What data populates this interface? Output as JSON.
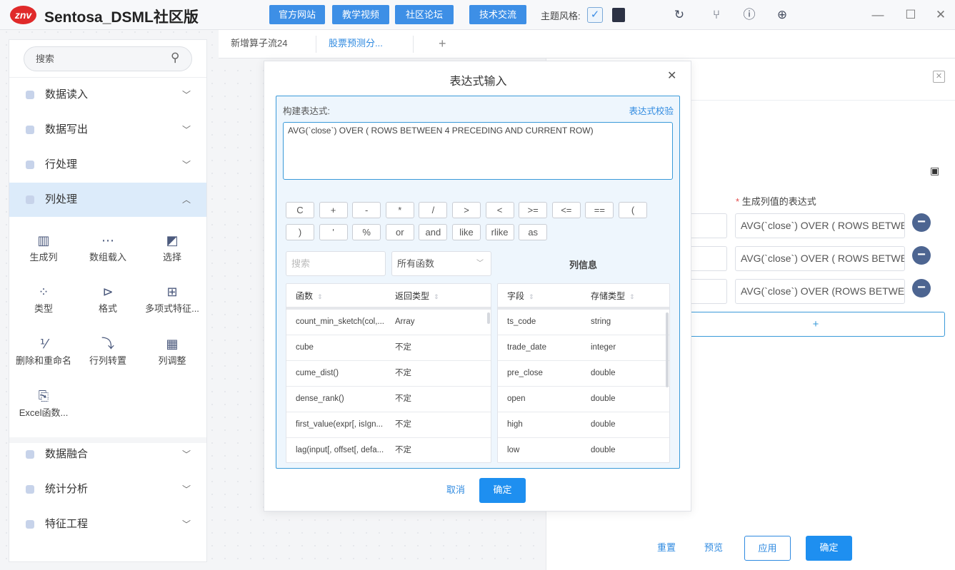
{
  "app": {
    "logo": "znv",
    "title": "Sentosa_DSML社区版"
  },
  "topbar": {
    "buttons": [
      "官方网站",
      "教学视频",
      "社区论坛",
      "技术交流"
    ],
    "theme_label": "主题风格:",
    "icons": [
      "refresh-icon",
      "branch-icon",
      "help-icon",
      "globe-icon"
    ],
    "window": [
      "minimize-icon",
      "maximize-icon",
      "close-icon"
    ]
  },
  "sidebar": {
    "search_placeholder": "搜索",
    "menu_top": [
      {
        "label": "数据读入"
      },
      {
        "label": "数据写出"
      },
      {
        "label": "行处理"
      },
      {
        "label": "列处理",
        "active": true
      }
    ],
    "tools": [
      {
        "label": "生成列",
        "icon": "▥"
      },
      {
        "label": "数组载入",
        "icon": "⋯"
      },
      {
        "label": "选择",
        "icon": "◩"
      },
      {
        "label": "类型",
        "icon": "⁘"
      },
      {
        "label": "格式",
        "icon": "⊳"
      },
      {
        "label": "多项式特征...",
        "icon": "⊞"
      },
      {
        "label": "删除和重命名",
        "icon": "⅟"
      },
      {
        "label": "行列转置",
        "icon": "⤵"
      },
      {
        "label": "列调整",
        "icon": "▦"
      },
      {
        "label": "Excel函数...",
        "icon": "⎘"
      }
    ],
    "menu_bottom": [
      {
        "label": "数据融合"
      },
      {
        "label": "统计分析"
      },
      {
        "label": "特征工程"
      }
    ]
  },
  "tabs": {
    "items": [
      "新增算子流24",
      "股票预测分..."
    ],
    "add": "+"
  },
  "right_panel": {
    "expr_label": "生成列值的表达式",
    "required_mark": "*",
    "rows": [
      "AVG(`close`) OVER ( ROWS BETWEE",
      "AVG(`close`) OVER ( ROWS BETWEE",
      "AVG(`close`) OVER (ROWS BETWEE"
    ],
    "add": "+",
    "reset": "重置",
    "preview": "预览",
    "apply": "应用",
    "confirm": "确定"
  },
  "dialog": {
    "title": "表达式输入",
    "build_label": "构建表达式:",
    "validate": "表达式校验",
    "expression": "AVG(`close`) OVER ( ROWS BETWEEN 4 PRECEDING AND CURRENT ROW)",
    "ops_row1": [
      "C",
      "+",
      "-",
      "*",
      "/",
      ">",
      "<",
      ">=",
      "<=",
      "==",
      "("
    ],
    "ops_row2": [
      ")",
      "'",
      "%",
      "or",
      "and",
      "like",
      "rlike",
      "as"
    ],
    "search_placeholder": "搜索",
    "func_filter": "所有函数",
    "col_info": "列信息",
    "func_table": {
      "headers": [
        "函数",
        "返回类型"
      ],
      "rows": [
        [
          "count_min_sketch(col,...",
          "Array"
        ],
        [
          "cube",
          "不定"
        ],
        [
          "cume_dist()",
          "不定"
        ],
        [
          "dense_rank()",
          "不定"
        ],
        [
          "first_value(expr[, isIgn...",
          "不定"
        ],
        [
          "lag(input[, offset[, defa...",
          "不定"
        ]
      ]
    },
    "col_table": {
      "headers": [
        "字段",
        "存储类型"
      ],
      "rows": [
        [
          "ts_code",
          "string"
        ],
        [
          "trade_date",
          "integer"
        ],
        [
          "pre_close",
          "double"
        ],
        [
          "open",
          "double"
        ],
        [
          "high",
          "double"
        ],
        [
          "low",
          "double"
        ]
      ]
    },
    "cancel": "取消",
    "confirm": "确定"
  }
}
